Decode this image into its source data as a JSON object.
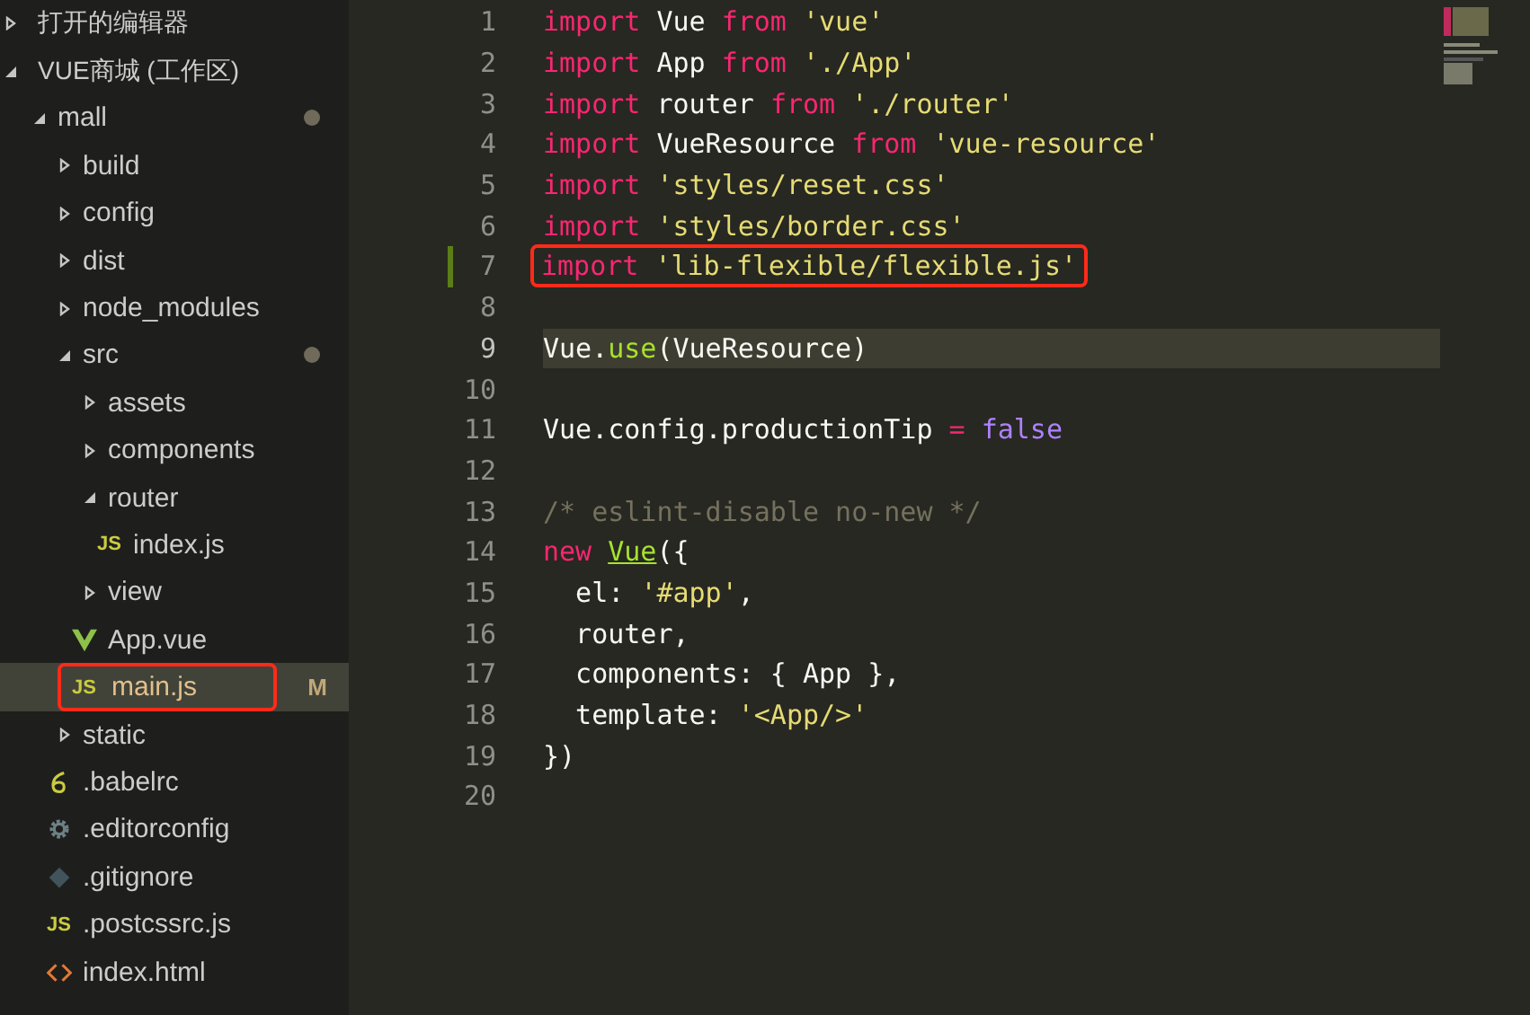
{
  "sidebar": {
    "sections": [
      {
        "title": "打开的编辑器",
        "expanded": false
      },
      {
        "title": "VUE商城 (工作区)",
        "expanded": true
      }
    ],
    "tree": [
      {
        "name": "mall",
        "kind": "folder",
        "expanded": true,
        "modified": true,
        "selected": false,
        "children": [
          {
            "name": "build",
            "kind": "folder",
            "expanded": false,
            "modified": false,
            "selected": false
          },
          {
            "name": "config",
            "kind": "folder",
            "expanded": false,
            "modified": false,
            "selected": false
          },
          {
            "name": "dist",
            "kind": "folder",
            "expanded": false,
            "modified": false,
            "selected": false
          },
          {
            "name": "node_modules",
            "kind": "folder",
            "expanded": false,
            "modified": false,
            "selected": false
          },
          {
            "name": "src",
            "kind": "folder",
            "expanded": true,
            "modified": true,
            "selected": false,
            "children": [
              {
                "name": "assets",
                "kind": "folder",
                "expanded": false,
                "modified": false,
                "selected": false
              },
              {
                "name": "components",
                "kind": "folder",
                "expanded": false,
                "modified": false,
                "selected": false
              },
              {
                "name": "router",
                "kind": "folder",
                "expanded": true,
                "modified": false,
                "selected": false,
                "children": [
                  {
                    "name": "index.js",
                    "kind": "js",
                    "icon_label": "JS",
                    "modified": false,
                    "selected": false
                  }
                ]
              },
              {
                "name": "view",
                "kind": "folder",
                "expanded": false,
                "modified": false,
                "selected": false
              },
              {
                "name": "App.vue",
                "kind": "vue",
                "modified": false,
                "selected": false
              },
              {
                "name": "main.js",
                "kind": "js",
                "icon_label": "JS",
                "modified": true,
                "badge": "M",
                "selected": true,
                "annotated": true
              }
            ]
          },
          {
            "name": "static",
            "kind": "folder",
            "expanded": false,
            "modified": false,
            "selected": false
          },
          {
            "name": ".babelrc",
            "kind": "babel",
            "modified": false,
            "selected": false
          },
          {
            "name": ".editorconfig",
            "kind": "config",
            "modified": false,
            "selected": false
          },
          {
            "name": ".gitignore",
            "kind": "git",
            "modified": false,
            "selected": false
          },
          {
            "name": ".postcssrc.js",
            "kind": "js",
            "icon_label": "JS",
            "modified": false,
            "selected": false
          },
          {
            "name": "index.html",
            "kind": "html",
            "modified": false,
            "selected": false
          }
        ]
      }
    ]
  },
  "editor": {
    "lines": [
      {
        "number": "1",
        "current": false,
        "changed": false,
        "tokens": [
          {
            "t": "import",
            "kind": "kw"
          },
          {
            "t": " Vue ",
            "kind": "id"
          },
          {
            "t": "from",
            "kind": "kw"
          },
          {
            "t": " 'vue'",
            "kind": "str"
          }
        ]
      },
      {
        "number": "2",
        "current": false,
        "changed": false,
        "tokens": [
          {
            "t": "import",
            "kind": "kw"
          },
          {
            "t": " App ",
            "kind": "id"
          },
          {
            "t": "from",
            "kind": "kw"
          },
          {
            "t": " './App'",
            "kind": "str"
          }
        ]
      },
      {
        "number": "3",
        "current": false,
        "changed": false,
        "tokens": [
          {
            "t": "import",
            "kind": "kw"
          },
          {
            "t": " router ",
            "kind": "id"
          },
          {
            "t": "from",
            "kind": "kw"
          },
          {
            "t": " './router'",
            "kind": "str"
          }
        ]
      },
      {
        "number": "4",
        "current": false,
        "changed": false,
        "tokens": [
          {
            "t": "import",
            "kind": "kw"
          },
          {
            "t": " VueResource ",
            "kind": "id"
          },
          {
            "t": "from",
            "kind": "kw"
          },
          {
            "t": " 'vue-resource'",
            "kind": "str"
          }
        ]
      },
      {
        "number": "5",
        "current": false,
        "changed": false,
        "tokens": [
          {
            "t": "import",
            "kind": "kw"
          },
          {
            "t": " 'styles/reset.css'",
            "kind": "str"
          }
        ]
      },
      {
        "number": "6",
        "current": false,
        "changed": false,
        "tokens": [
          {
            "t": "import",
            "kind": "kw"
          },
          {
            "t": " 'styles/border.css'",
            "kind": "str"
          }
        ]
      },
      {
        "number": "7",
        "current": false,
        "changed": true,
        "annotated": true,
        "tokens": [
          {
            "t": "import",
            "kind": "kw"
          },
          {
            "t": " 'lib-flexible/flexible.js'",
            "kind": "str"
          }
        ]
      },
      {
        "number": "8",
        "current": false,
        "changed": false
      },
      {
        "number": "9",
        "current": true,
        "changed": false,
        "tokens": [
          {
            "t": "Vue.",
            "kind": "id"
          },
          {
            "t": "use",
            "kind": "fn"
          },
          {
            "t": "(VueResource)",
            "kind": "id"
          }
        ]
      },
      {
        "number": "10",
        "current": false,
        "changed": false
      },
      {
        "number": "11",
        "current": false,
        "changed": false,
        "tokens": [
          {
            "t": "Vue.config.productionTip ",
            "kind": "id"
          },
          {
            "t": "=",
            "kind": "kw"
          },
          {
            "t": " false",
            "kind": "bool"
          }
        ]
      },
      {
        "number": "12",
        "current": false,
        "changed": false
      },
      {
        "number": "13",
        "current": false,
        "changed": false,
        "tokens": [
          {
            "t": "/* eslint-disable no-new */",
            "kind": "cmt"
          }
        ]
      },
      {
        "number": "14",
        "current": false,
        "changed": false,
        "tokens": [
          {
            "t": "new ",
            "kind": "kw"
          },
          {
            "t": "Vue",
            "kind": "cls"
          },
          {
            "t": "({",
            "kind": "id"
          }
        ]
      },
      {
        "number": "15",
        "current": false,
        "changed": false,
        "tokens": [
          {
            "t": "  el: ",
            "kind": "id"
          },
          {
            "t": "'#app'",
            "kind": "str"
          },
          {
            "t": ",",
            "kind": "id"
          }
        ]
      },
      {
        "number": "16",
        "current": false,
        "changed": false,
        "tokens": [
          {
            "t": "  router,",
            "kind": "id"
          }
        ]
      },
      {
        "number": "17",
        "current": false,
        "changed": false,
        "tokens": [
          {
            "t": "  components: { App },",
            "kind": "id"
          }
        ]
      },
      {
        "number": "18",
        "current": false,
        "changed": false,
        "tokens": [
          {
            "t": "  template: ",
            "kind": "id"
          },
          {
            "t": "'<App/>'",
            "kind": "str"
          }
        ]
      },
      {
        "number": "19",
        "current": false,
        "changed": false,
        "tokens": [
          {
            "t": "})",
            "kind": "id"
          }
        ]
      },
      {
        "number": "20",
        "current": false,
        "changed": false
      }
    ]
  }
}
